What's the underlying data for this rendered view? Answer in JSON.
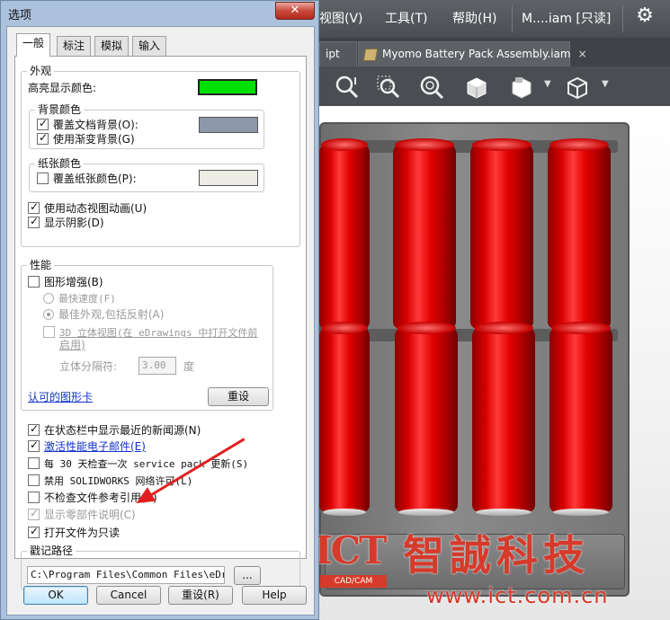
{
  "app": {
    "menu": [
      "视图(V)",
      "工具(T)",
      "帮助(H)"
    ],
    "file_title": "M....iam [只读]",
    "tabs": [
      {
        "label": "ipt"
      },
      {
        "label": "Myomo Battery Pack Assembly.iam",
        "close": "×"
      }
    ],
    "toolbar_icons": [
      "zoom-to-fit-icon",
      "zoom-area-icon",
      "zoom-in-out-icon",
      "view-orientation-icon",
      "display-style-icon",
      "section-view-icon"
    ]
  },
  "dialog": {
    "title": "选项",
    "close": "✕",
    "tabs": [
      "一般",
      "标注",
      "模拟",
      "输入"
    ],
    "appearance": {
      "label": "外观",
      "highlight_label": "高亮显示颜色:",
      "highlight_color": "#00e000",
      "bg_group": {
        "label": "背景颜色",
        "override_doc_bg": "覆盖文档背景(O):",
        "override_doc_bg_checked": true,
        "override_color": "#8d97aa",
        "gradient_bg": "使用渐变背景(G)",
        "gradient_bg_checked": true
      },
      "paper_group": {
        "label": "纸张颜色",
        "override_paper": "覆盖纸张颜色(P):",
        "override_paper_checked": false,
        "paper_color": "#ecebe4"
      },
      "dynamic_anim": "使用动态视图动画(U)",
      "dynamic_anim_checked": true,
      "show_shadows": "显示阴影(D)",
      "show_shadows_checked": true
    },
    "performance": {
      "label": "性能",
      "graphics_enhance": "图形增强(B)",
      "graphics_enhance_checked": false,
      "fastest": "最快速度(F)",
      "best_look": "最佳外观,包括反射(A)",
      "stereo_line1": "3D 立体视图(在 eDrawings 中打开文件前",
      "stereo_line2": "启用)",
      "stereo_separation_label": "立体分隔符:",
      "stereo_separation_value": "3.00",
      "stereo_unit": "度",
      "certified_cards": "认可的图形卡",
      "reset": "重设"
    },
    "options": [
      {
        "label": "在状态栏中显示最近的新闻源(N)",
        "checked": true,
        "style": "normal"
      },
      {
        "label": "激活性能电子邮件(E)",
        "checked": true,
        "style": "link"
      },
      {
        "label": "每 30 天检查一次 service pack 更新(S)",
        "checked": false,
        "style": "mono"
      },
      {
        "label": "禁用 SOLIDWORKS 网络许可(L)",
        "checked": false,
        "style": "mono"
      },
      {
        "label": "不检查文件参考引用(R)",
        "checked": false,
        "style": "normal"
      },
      {
        "label": "显示零部件说明(C)",
        "checked": true,
        "style": "disabled"
      },
      {
        "label": "打开文件为只读",
        "checked": true,
        "style": "normal"
      }
    ],
    "stamp_path": {
      "label": "戳记路径",
      "value": "C:\\Program Files\\Common Files\\eDrawi",
      "browse": "..."
    },
    "buttons": {
      "ok": "OK",
      "cancel": "Cancel",
      "reset": "重设(R)",
      "help": "Help"
    }
  },
  "watermark": {
    "logo": "ICT",
    "logo_sub": "CAD/CAM",
    "company": "智誠科技",
    "url": "www.ict.com.cn",
    "color": "#d63a2a"
  }
}
